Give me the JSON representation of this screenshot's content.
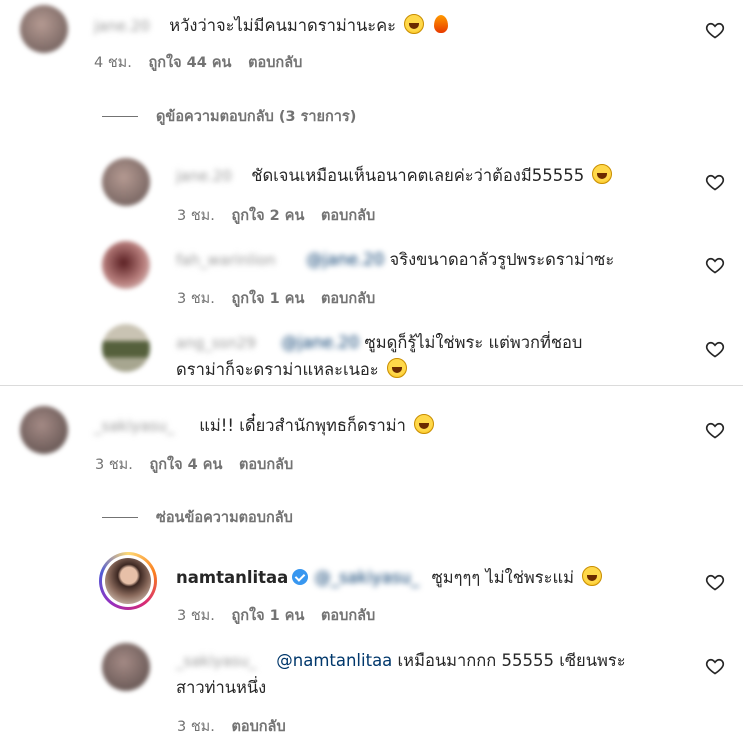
{
  "icons": {
    "heart": "heart-outline-icon",
    "verified": "verified-badge-icon",
    "laugh": "tears-of-joy-emoji",
    "fire": "fire-emoji"
  },
  "colors": {
    "meta": "#737373",
    "mention": "#00376b",
    "verified": "#3897f0"
  },
  "thread1": {
    "comment": {
      "username": "jane.20",
      "text": "หวังว่าจะไม่มีคนมาดราม่านะคะ",
      "time": "4 ชม.",
      "likes": "ถูกใจ 44 คน",
      "reply": "ตอบกลับ"
    },
    "toggle_label": "ดูข้อความตอบกลับ (3 รายการ)",
    "replies": [
      {
        "username": "jane.20",
        "text": "ชัดเจนเหมือนเห็นอนาคตเลยค่ะว่าต้องมี55555",
        "time": "3 ชม.",
        "likes": "ถูกใจ 2 คน",
        "reply": "ตอบกลับ"
      },
      {
        "username": "fah_warinlion",
        "mention": "@jane.20",
        "text": "จริงขนาดอาลัวรูปพระดราม่าซะ",
        "time": "3 ชม.",
        "likes": "ถูกใจ 1 คน",
        "reply": "ตอบกลับ"
      },
      {
        "username": "ang_ssn29",
        "mention": "@jane.20",
        "text_line1": "ซูมดูก็รู้ไม่ใช่พระ แต่พวกที่ชอบ",
        "text_line2": "ดราม่าก็จะดราม่าแหละเนอะ"
      }
    ]
  },
  "thread2": {
    "comment": {
      "username": "_sakiyasu_",
      "text": "แม่!! เดี๋ยวสำนักพุทธก็ดราม่า",
      "time": "3 ชม.",
      "likes": "ถูกใจ 4 คน",
      "reply": "ตอบกลับ"
    },
    "toggle_label": "ซ่อนข้อความตอบกลับ",
    "replies": [
      {
        "username": "namtanlitaa",
        "mention": "@_sakiyasu_",
        "text": "ซูมๆๆๆ ไม่ใช่พระแม่",
        "time": "3 ชม.",
        "likes": "ถูกใจ 1 คน",
        "reply": "ตอบกลับ"
      },
      {
        "username": "_sakiyasu_",
        "mention": "@namtanlitaa",
        "text_line1": "เหมือนมากกก 55555 เซียนพระ",
        "text_line2": "สาวท่านหนึ่ง",
        "time": "3 ชม.",
        "reply": "ตอบกลับ"
      }
    ]
  }
}
